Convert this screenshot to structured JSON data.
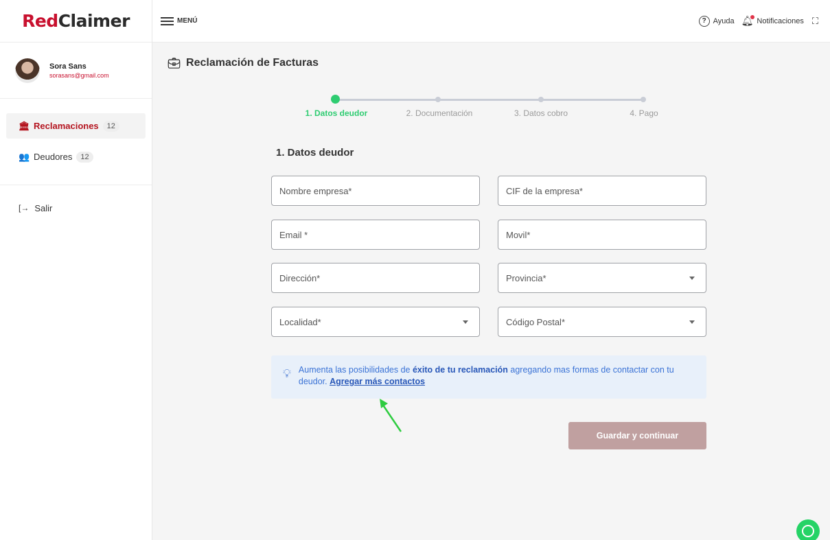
{
  "brand": {
    "part1": "Red",
    "part2": "Claimer"
  },
  "user": {
    "name": "Sora Sans",
    "email": "sorasans@gmail.com"
  },
  "sidebar": {
    "items": [
      {
        "label": "Reclamaciones",
        "count": "12",
        "icon": "bank-icon"
      },
      {
        "label": "Deudores",
        "count": "12",
        "icon": "users-icon"
      }
    ],
    "logout_label": "Salir"
  },
  "topbar": {
    "menu_label": "MENÚ",
    "help_label": "Ayuda",
    "notifications_label": "Notificaciones"
  },
  "page": {
    "title": "Reclamación de Facturas"
  },
  "stepper": {
    "steps": [
      "1. Datos deudor",
      "2. Documentación",
      "3. Datos cobro",
      "4. Pago"
    ],
    "active_index": 0
  },
  "form": {
    "section_title": "1. Datos deudor",
    "fields": {
      "company_name": "Nombre empresa*",
      "cif": "CIF de la empresa*",
      "email": "Email *",
      "mobile": "Movil*",
      "address": "Dirección*",
      "province": "Provincia*",
      "locality": "Localidad*",
      "postal_code": "Código Postal*"
    }
  },
  "info": {
    "text_before": "Aumenta las posibilidades de ",
    "text_bold": "éxito de tu reclamación",
    "text_after": " agregando mas formas de contactar con tu deudor. ",
    "link": "Agregar más contactos"
  },
  "actions": {
    "save_label": "Guardar y continuar"
  },
  "colors": {
    "brand_red": "#c8102e",
    "step_active": "#2ecc71",
    "info_bg": "#e8f0fa",
    "save_bg": "#c0a0a0"
  }
}
